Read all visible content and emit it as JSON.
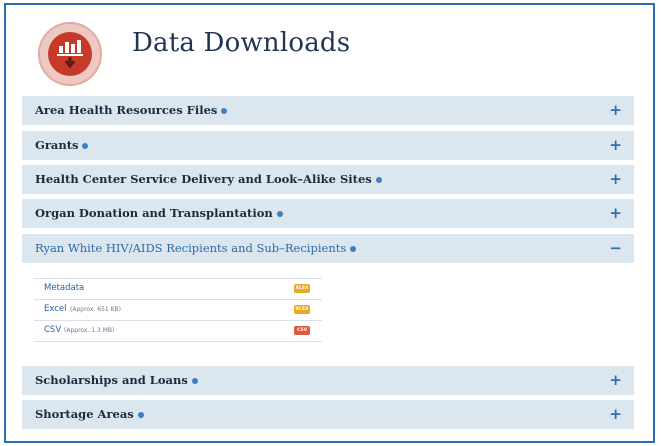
{
  "header": {
    "title": "Data Downloads",
    "logo_icon": "download-chart-icon"
  },
  "accordion": [
    {
      "label": "Area Health Resources Files",
      "toggle": "+"
    },
    {
      "label": "Grants",
      "toggle": "+"
    },
    {
      "label": "Health Center Service Delivery and Look–Alike Sites",
      "toggle": "+"
    },
    {
      "label": "Organ Donation and Transplantation",
      "toggle": "+"
    },
    {
      "label": "Ryan White HIV/AIDS Recipients and Sub–Recipients",
      "toggle": "−"
    },
    {
      "label": "Scholarships and Loans",
      "toggle": "+"
    },
    {
      "label": "Shortage Areas",
      "toggle": "+"
    }
  ],
  "downloads": [
    {
      "name": "Metadata",
      "size": "",
      "badge": "XLSX",
      "badge_color": "#e9a825"
    },
    {
      "name": "Excel",
      "size": "(Approx. 651 KB)",
      "badge": "XLSX",
      "badge_color": "#e9a825"
    },
    {
      "name": "CSV",
      "size": "(Approx. 1.3 MB)",
      "badge": "CSV",
      "badge_color": "#e0573f"
    }
  ],
  "colors": {
    "accent": "#2f6db3",
    "header_bg": "#dce6ef",
    "logo_red": "#c73a2a"
  }
}
